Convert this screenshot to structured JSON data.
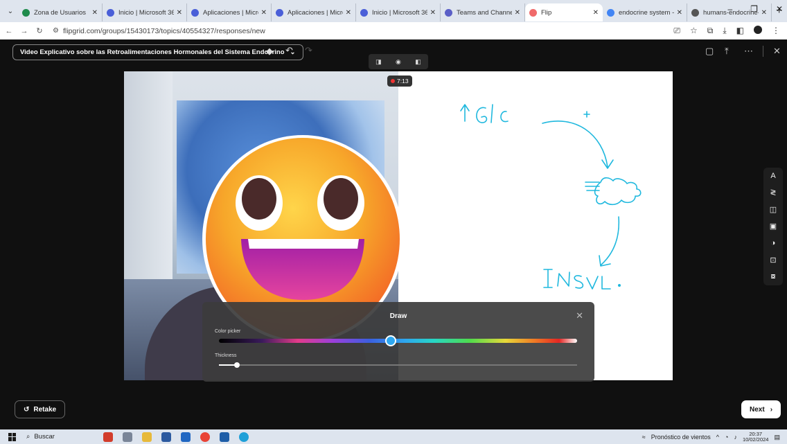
{
  "browser": {
    "tabs": [
      {
        "title": "Zona de Usuarios",
        "color": "#1f8b4c"
      },
      {
        "title": "Inicio | Microsoft 365",
        "color": "#4a5fd8"
      },
      {
        "title": "Aplicaciones | Micros",
        "color": "#4a5fd8"
      },
      {
        "title": "Aplicaciones | Micros",
        "color": "#4a5fd8"
      },
      {
        "title": "Inicio | Microsoft 365",
        "color": "#4a5fd8"
      },
      {
        "title": "Teams and Channels",
        "color": "#5b5fc7"
      },
      {
        "title": "Flip",
        "color": "#f06a6a"
      },
      {
        "title": "endocrine system - S",
        "color": "#4285f4"
      },
      {
        "title": "humans-endocrine-",
        "color": "#555555"
      }
    ],
    "url": "flipgrid.com/groups/15430173/topics/40554327/responses/new"
  },
  "app": {
    "topic_title": "Video Explicativo sobre las Retroalimentaciones Hormonales del Sistema Endocrino",
    "timer": "7:13",
    "draw_panel": {
      "title": "Draw",
      "color_picker_label": "Color picker",
      "thickness_label": "Thickness",
      "hue_position": 0.48,
      "thickness_value": 0.05
    },
    "retake_label": "Retake",
    "next_label": "Next",
    "ink_color": "#1fb8de"
  },
  "taskbar": {
    "search_label": "Buscar",
    "weather": "Pronóstico de vientos",
    "time": "20:37",
    "date": "10/02/2024"
  }
}
